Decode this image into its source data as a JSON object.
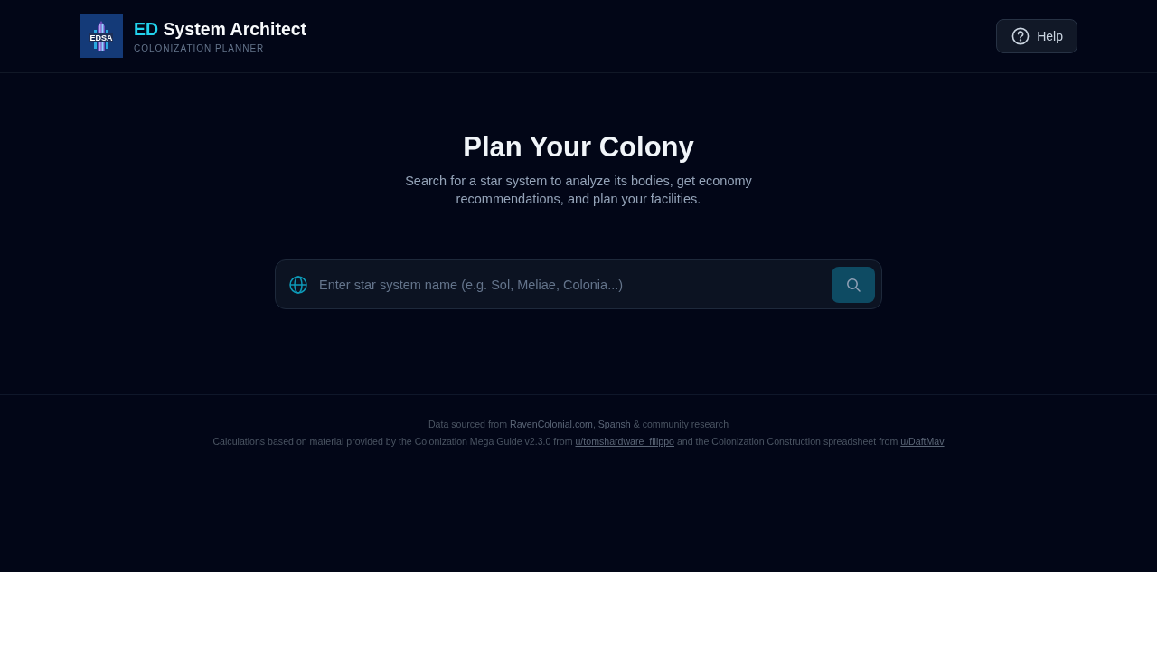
{
  "header": {
    "logo": {
      "text": "EDSA"
    },
    "title_accent": "ED",
    "title": "System Architect",
    "tagline": "COLONIZATION PLANNER",
    "help_button": "Help"
  },
  "hero": {
    "title": "Plan Your Colony",
    "subtitle": "Search for a star system to analyze its bodies, get economy recommendations, and plan your facilities."
  },
  "search": {
    "placeholder": "Enter star system name (e.g. Sol, Meliae, Colonia...)"
  },
  "footer": {
    "lines": [
      {
        "segments": [
          {
            "kind": "text",
            "text": "Data sourced from "
          },
          {
            "kind": "link",
            "text": "RavenColonial.com"
          },
          {
            "kind": "text",
            "text": ", "
          },
          {
            "kind": "link",
            "text": "Spansh"
          },
          {
            "kind": "text",
            "text": " & community research"
          }
        ]
      },
      {
        "segments": [
          {
            "kind": "text",
            "text": "Calculations based on material provided by the Colonization Mega Guide v2.3.0 from "
          },
          {
            "kind": "link",
            "text": "u/tomshardware_filippo"
          },
          {
            "kind": "text",
            "text": " and the Colonization Construction spreadsheet from "
          },
          {
            "kind": "link",
            "text": "u/DaftMav"
          }
        ]
      }
    ]
  }
}
